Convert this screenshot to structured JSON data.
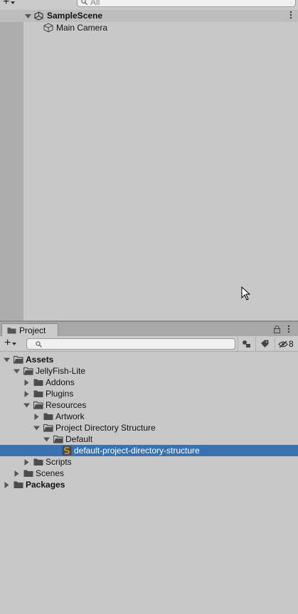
{
  "hierarchy": {
    "search_placeholder": "All",
    "scene_name": "SampleScene",
    "objects": [
      "Main Camera"
    ]
  },
  "project": {
    "tab_label": "Project",
    "hidden_count": "8",
    "tree": [
      {
        "label": "Assets",
        "bold": true,
        "depth": 0,
        "state": "expanded",
        "icon": "folder-open-icon"
      },
      {
        "label": "JellyFish-Lite",
        "bold": false,
        "depth": 1,
        "state": "expanded",
        "icon": "folder-open-icon"
      },
      {
        "label": "Addons",
        "bold": false,
        "depth": 2,
        "state": "collapsed",
        "icon": "folder-icon"
      },
      {
        "label": "Plugins",
        "bold": false,
        "depth": 2,
        "state": "collapsed",
        "icon": "folder-icon"
      },
      {
        "label": "Resources",
        "bold": false,
        "depth": 2,
        "state": "expanded",
        "icon": "folder-open-icon"
      },
      {
        "label": "Artwork",
        "bold": false,
        "depth": 3,
        "state": "collapsed",
        "icon": "folder-icon"
      },
      {
        "label": "Project Directory Structure",
        "bold": false,
        "depth": 3,
        "state": "expanded",
        "icon": "folder-open-icon"
      },
      {
        "label": "Default",
        "bold": false,
        "depth": 4,
        "state": "expanded",
        "icon": "folder-open-icon"
      },
      {
        "label": "default-project-directory-structure",
        "bold": false,
        "depth": 5,
        "state": "leaf",
        "icon": "asset-file-icon",
        "selected": true
      },
      {
        "label": "Scripts",
        "bold": false,
        "depth": 2,
        "state": "collapsed",
        "icon": "folder-icon"
      },
      {
        "label": "Scenes",
        "bold": false,
        "depth": 1,
        "state": "collapsed",
        "icon": "folder-icon"
      },
      {
        "label": "Packages",
        "bold": true,
        "depth": 0,
        "state": "collapsed",
        "icon": "folder-icon"
      }
    ]
  },
  "colors": {
    "selection": "#3a72b0",
    "panel": "#c8c8c8",
    "gutter": "#adadad",
    "tabbar": "#a8a8a8"
  }
}
